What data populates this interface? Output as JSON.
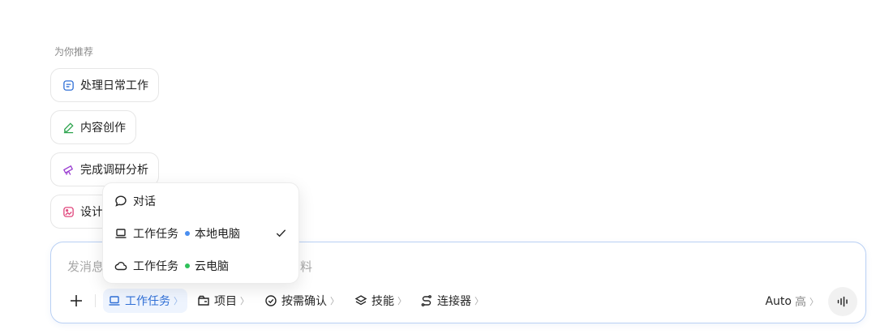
{
  "recommend": {
    "title": "为你推荐",
    "items": [
      {
        "label": "处理日常工作",
        "icon": "note-icon",
        "color": "#2f6fd6"
      },
      {
        "label": "内容创作",
        "icon": "pen-icon",
        "color": "#2da44e"
      },
      {
        "label": "完成调研分析",
        "icon": "telescope-icon",
        "color": "#9b3fd1"
      },
      {
        "label": "设计",
        "icon": "image-icon",
        "color": "#e0457b"
      }
    ]
  },
  "composer": {
    "placeholder_left": "发消息",
    "placeholder_right": "资料",
    "toolbar": {
      "mode": "工作任务",
      "project": "项目",
      "confirm": "按需确认",
      "skills": "技能",
      "connectors": "连接器",
      "model": "Auto",
      "level": "高",
      "chevron": "〉"
    }
  },
  "mode_menu": {
    "items": [
      {
        "label": "对话",
        "icon": "chat-bubble-icon"
      },
      {
        "label": "工作任务",
        "sub": "本地电脑",
        "icon": "laptop-icon",
        "dot_color": "#4a8ef0",
        "checked": true
      },
      {
        "label": "工作任务",
        "sub": "云电脑",
        "icon": "cloud-icon",
        "dot_color": "#2fc15a",
        "checked": false
      }
    ]
  },
  "colors": {
    "accent": "#2f6fd6",
    "border_focus": "#b9d0f4"
  }
}
